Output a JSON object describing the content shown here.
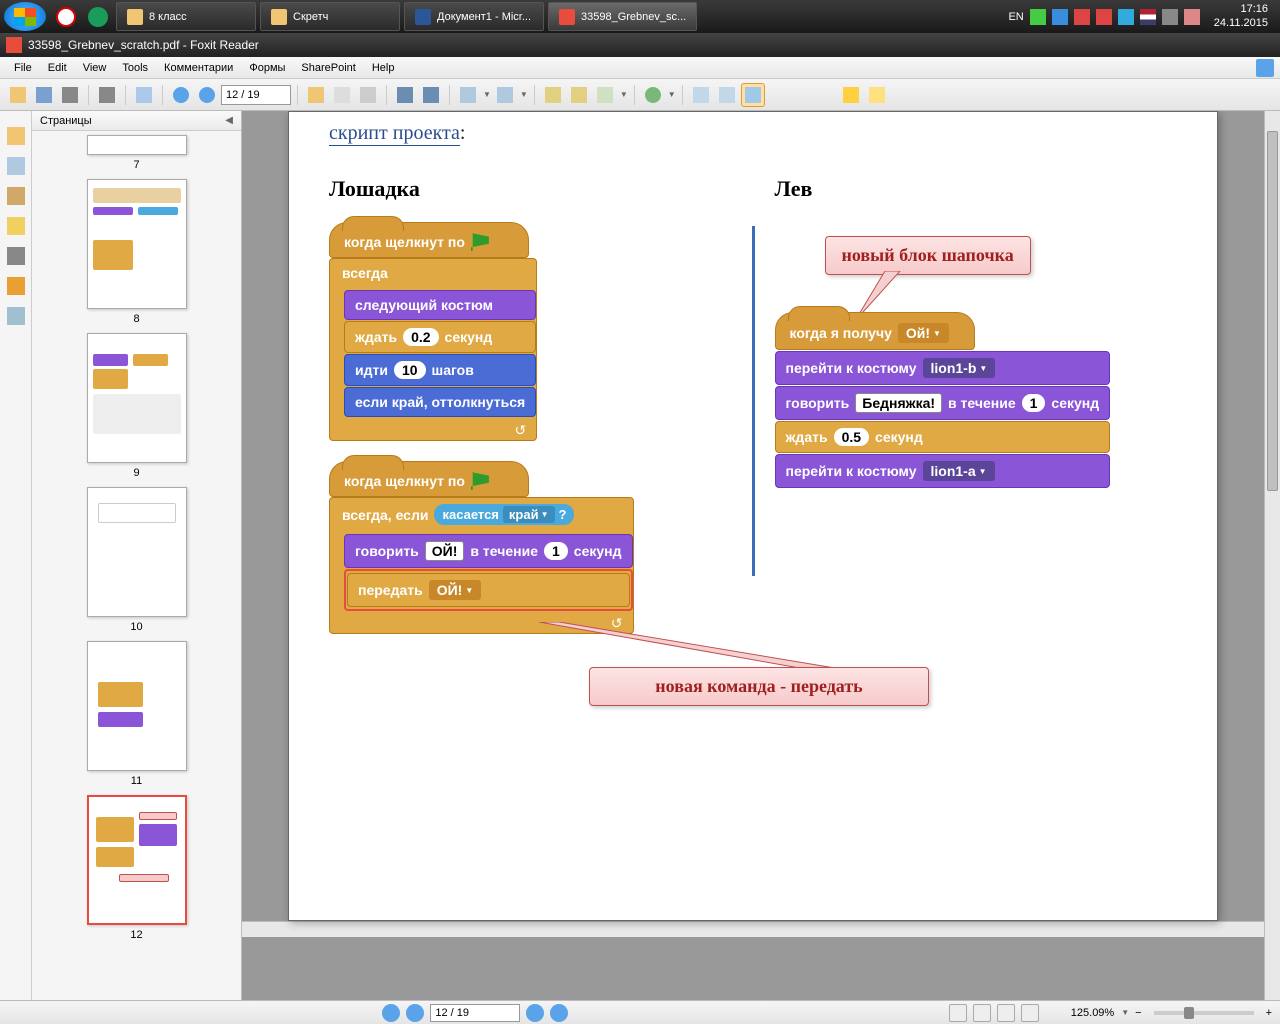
{
  "taskbar": {
    "items": [
      {
        "label": "8 класс"
      },
      {
        "label": "Скретч"
      },
      {
        "label": "Документ1 - Micr..."
      },
      {
        "label": "33598_Grebnev_sc..."
      }
    ],
    "lang": "EN",
    "time": "17:16",
    "date": "24.11.2015"
  },
  "window": {
    "title": "33598_Grebnev_scratch.pdf - Foxit Reader"
  },
  "menu": [
    "File",
    "Edit",
    "View",
    "Tools",
    "Комментарии",
    "Формы",
    "SharePoint",
    "Help"
  ],
  "toolbar": {
    "page_field": "12 / 19"
  },
  "sidebar": {
    "title": "Страницы",
    "thumbs": [
      "7",
      "8",
      "9",
      "10",
      "11",
      "12"
    ]
  },
  "document": {
    "heading": "скрипт проекта",
    "col1_title": "Лошадка",
    "col2_title": "Лев",
    "callout1": "новый блок шапочка",
    "callout2": "новая команда - передать",
    "script1": {
      "hat": "когда щелкнут по",
      "forever": "всегда",
      "next_costume": "следующий костюм",
      "wait": "ждать",
      "wait_val": "0.2",
      "seconds": "секунд",
      "move": "идти",
      "move_val": "10",
      "steps": "шагов",
      "bounce": "если край, оттолкнуться"
    },
    "script2": {
      "hat": "когда щелкнут по",
      "forever_if": "всегда, если",
      "touching": "касается",
      "edge": "край",
      "q": "?",
      "say": "говорить",
      "say_val": "ОЙ!",
      "for": "в течение",
      "say_dur": "1",
      "sec": "секунд",
      "broadcast": "передать",
      "msg": "ОЙ!"
    },
    "script3": {
      "hat": "когда я получу",
      "hat_msg": "Ой!",
      "switch1": "перейти к костюму",
      "cost1": "lion1-b",
      "say": "говорить",
      "say_val": "Бедняжка!",
      "for": "в течение",
      "dur": "1",
      "sec": "секунд",
      "wait": "ждать",
      "wait_val": "0.5",
      "sec2": "секунд",
      "switch2": "перейти к костюму",
      "cost2": "lion1-a"
    }
  },
  "statusbar": {
    "page_field": "12 / 19",
    "zoom": "125.09%"
  }
}
